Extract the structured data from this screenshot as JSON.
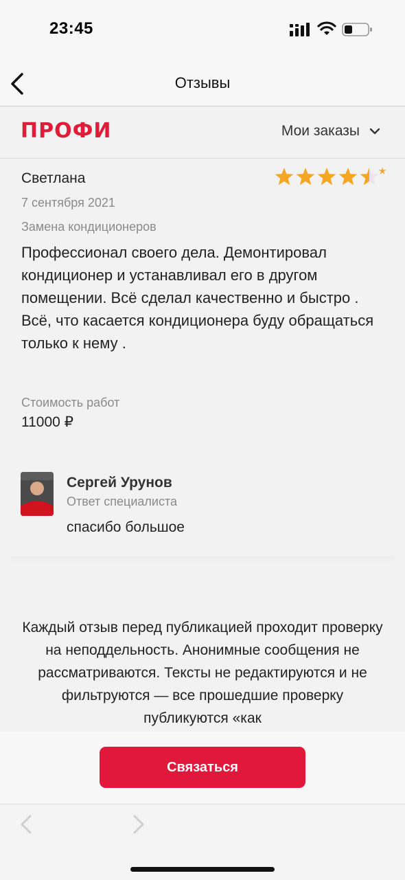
{
  "status_bar": {
    "time": "23:45"
  },
  "nav": {
    "title": "Отзывы"
  },
  "site": {
    "logo": "ПРОФИ",
    "my_orders": "Мои заказы"
  },
  "review": {
    "author": "Светлана",
    "rating": 4.5,
    "rating_max": 5,
    "date": "7 сентября 2021",
    "service": "Замена кондиционеров",
    "text": "Профессионал своего дела. Демонтировал кондиционер и устанавливал его в другом помещении. Всё сделал качественно и быстро .\nВсё, что касается кондиционера буду обращаться только к нему .",
    "cost_label": "Стоимость работ",
    "cost_value": "11000 ₽"
  },
  "reply": {
    "name": "Сергей Урунов",
    "role": "Ответ специалиста",
    "text": "спасибо большое"
  },
  "disclaimer": "Каждый отзыв перед публикацией проходит проверку на неподдельность. Анонимные сообщения не рассматриваются. Тексты не редактируются и не фильтруются — все прошедшие проверку публикуются «как",
  "actions": {
    "contact": "Связаться"
  },
  "colors": {
    "brand": "#e11b38",
    "button": "#e0193a",
    "star": "#f5a623"
  },
  "icons": {
    "back": "chevron-left-icon",
    "dropdown": "chevron-down-icon",
    "star": "star-icon",
    "browser_back": "browser-back-icon",
    "browser_forward": "browser-forward-icon"
  }
}
